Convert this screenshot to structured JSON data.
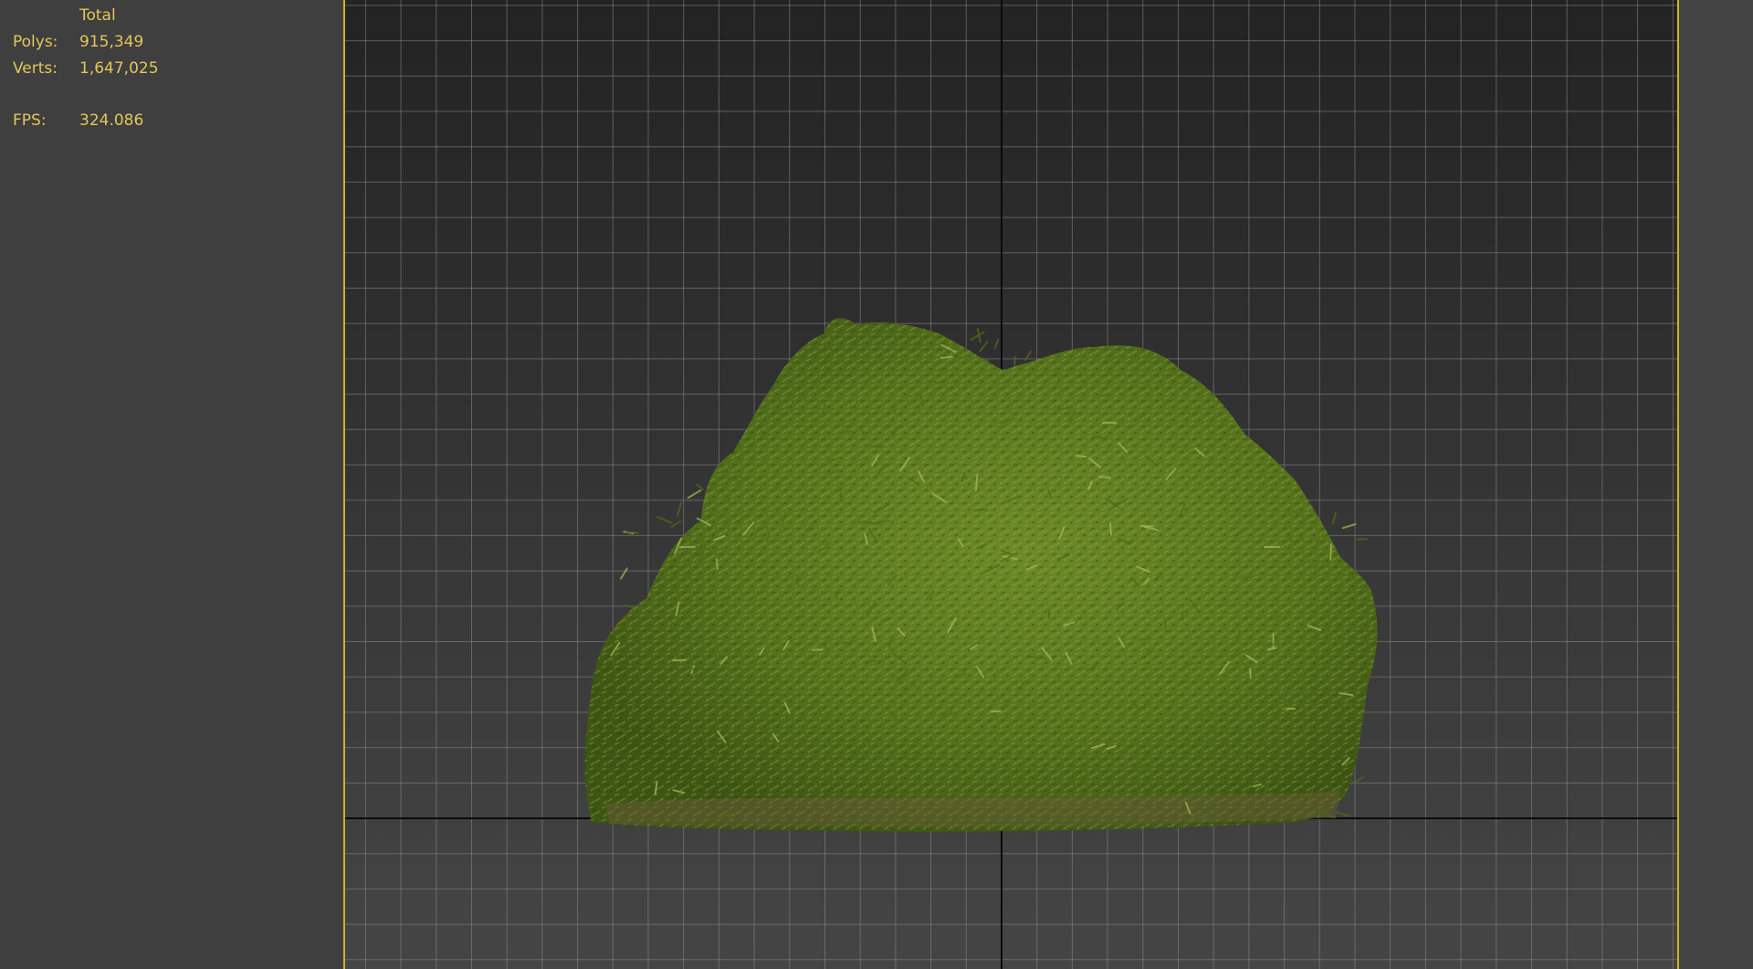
{
  "stats": {
    "header": "Total",
    "polys_label": "Polys:",
    "polys_value": "915,349",
    "verts_label": "Verts:",
    "verts_value": "1,647,025",
    "fps_label": "FPS:",
    "fps_value": "324.086"
  },
  "viewport": {
    "object": "bush-model",
    "grid": true,
    "colors": {
      "stats_text": "#e2c65a",
      "active_border": "#c9b52a",
      "grid_line": "#8a8a8a",
      "axis_line": "#0a0a0a",
      "foliage": "#5f7f22"
    }
  }
}
